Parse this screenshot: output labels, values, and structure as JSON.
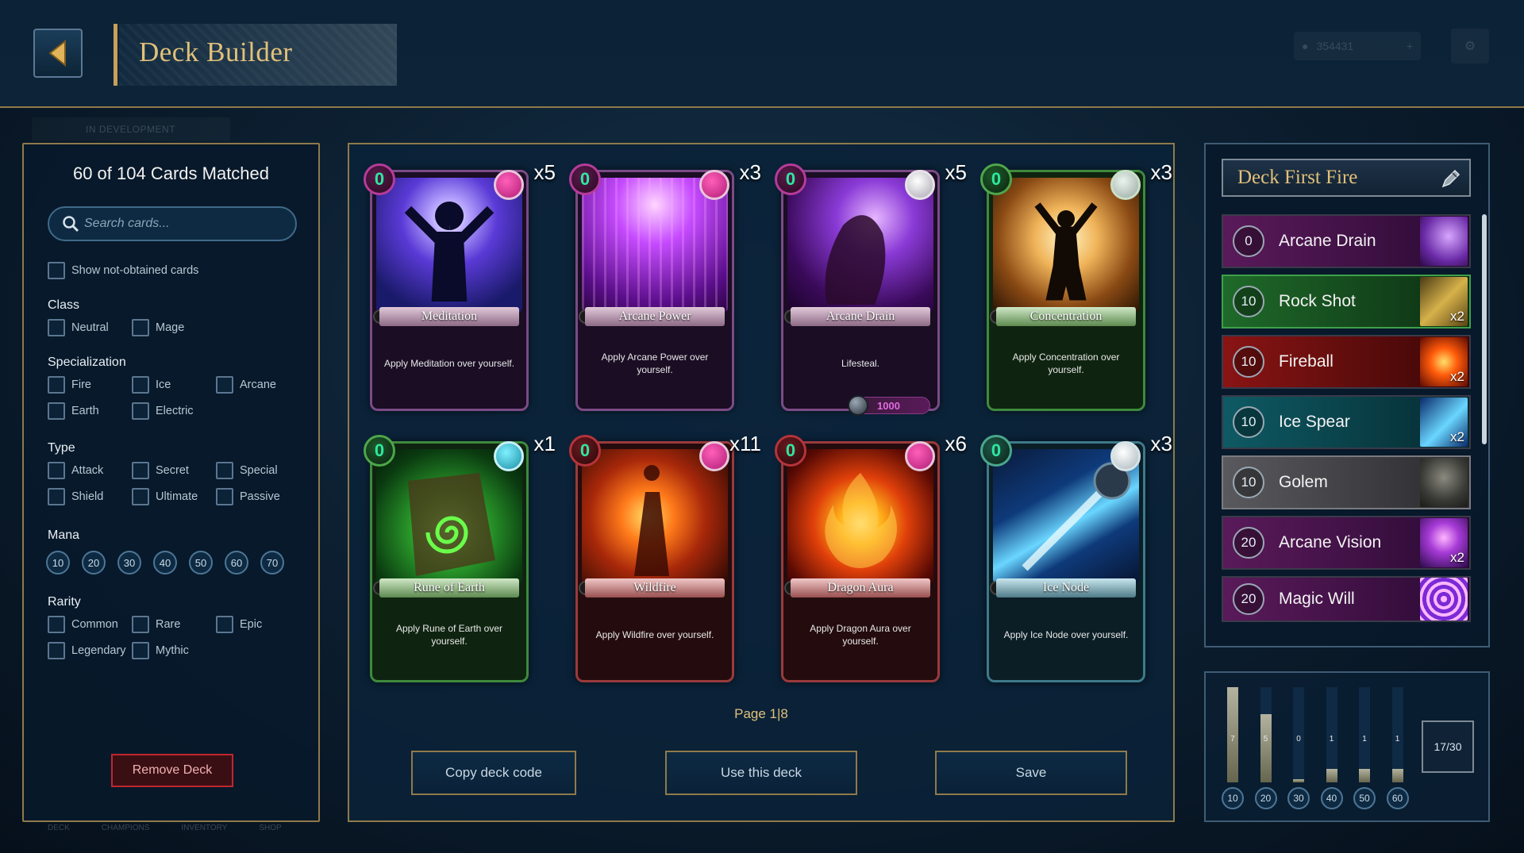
{
  "header": {
    "title": "Deck Builder",
    "currency_value": "354431",
    "dev_badge": "IN DEVELOPMENT"
  },
  "filters": {
    "matched_text": "60 of 104 Cards Matched",
    "search_placeholder": "Search cards...",
    "show_not_obtained": "Show not-obtained cards",
    "class_title": "Class",
    "class_options": [
      "Neutral",
      "Mage"
    ],
    "spec_title": "Specialization",
    "spec_options": [
      "Fire",
      "Ice",
      "Arcane",
      "Earth",
      "Electric"
    ],
    "type_title": "Type",
    "type_options": [
      "Attack",
      "Secret",
      "Special",
      "Shield",
      "Ultimate",
      "Passive"
    ],
    "mana_title": "Mana",
    "mana_options": [
      "10",
      "20",
      "30",
      "40",
      "50",
      "60",
      "70"
    ],
    "rarity_title": "Rarity",
    "rarity_options": [
      "Common",
      "Rare",
      "Epic",
      "Legendary",
      "Mythic"
    ],
    "remove_deck": "Remove Deck"
  },
  "bottom_nav": [
    "DECK",
    "CHAMPIONS",
    "INVENTORY",
    "SHOP"
  ],
  "cards": [
    {
      "name": "Meditation",
      "cost": "0",
      "count": "x5",
      "desc": "Apply Meditation over yourself."
    },
    {
      "name": "Arcane Power",
      "cost": "0",
      "count": "x3",
      "desc": "Apply Arcane Power over yourself."
    },
    {
      "name": "Arcane Drain",
      "cost": "0",
      "count": "x5",
      "desc": "Lifesteal.",
      "price": "1000"
    },
    {
      "name": "Concentration",
      "cost": "0",
      "count": "x3",
      "desc": "Apply Concentration over yourself."
    },
    {
      "name": "Rune of Earth",
      "cost": "0",
      "count": "x1",
      "desc": "Apply Rune of Earth over yourself."
    },
    {
      "name": "Wildfire",
      "cost": "0",
      "count": "x11",
      "desc": "Apply Wildfire over yourself."
    },
    {
      "name": "Dragon Aura",
      "cost": "0",
      "count": "x6",
      "desc": "Apply Dragon Aura over yourself."
    },
    {
      "name": "Ice Node",
      "cost": "0",
      "count": "x3",
      "desc": "Apply Ice Node over yourself."
    }
  ],
  "pagination": {
    "text": "Page 1|8"
  },
  "actions": {
    "copy": "Copy deck code",
    "use": "Use this deck",
    "save": "Save"
  },
  "deck": {
    "name": "Deck First Fire",
    "items": [
      {
        "cost": "0",
        "name": "Arcane Drain",
        "mult": ""
      },
      {
        "cost": "10",
        "name": "Rock Shot",
        "mult": "x2"
      },
      {
        "cost": "10",
        "name": "Fireball",
        "mult": "x2"
      },
      {
        "cost": "10",
        "name": "Ice Spear",
        "mult": "x2"
      },
      {
        "cost": "10",
        "name": "Golem",
        "mult": ""
      },
      {
        "cost": "20",
        "name": "Arcane Vision",
        "mult": "x2"
      },
      {
        "cost": "20",
        "name": "Magic Will",
        "mult": ""
      }
    ]
  },
  "mana_curve": {
    "labels": [
      "10",
      "20",
      "30",
      "40",
      "50",
      "60"
    ],
    "counts": [
      "7",
      "5",
      "0",
      "1",
      "1",
      "1"
    ],
    "deck_count": "17/30"
  },
  "colors": {
    "gold": "#e2c07a",
    "border_gold": "#8f7a4a",
    "mana_green": "#2ee8a0",
    "remove_red": "#c0262d"
  }
}
